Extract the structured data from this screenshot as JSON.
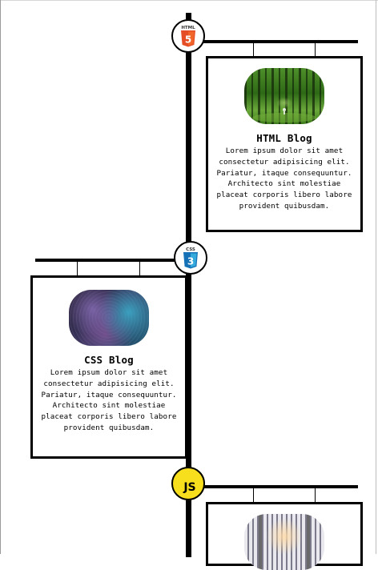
{
  "timeline": {
    "entries": [
      {
        "icon": "html5-icon",
        "icon_caption": "HTML",
        "icon_symbol": "5",
        "title": "HTML Blog",
        "body": "Lorem ipsum dolor sit amet consectetur adipisicing elit. Pariatur, itaque consequuntur. Architecto sint molestiae placeat corporis libero labore provident quibusdam.",
        "image": "forest-image",
        "side": "right"
      },
      {
        "icon": "css3-icon",
        "icon_caption": "CSS",
        "icon_symbol": "3",
        "title": "CSS Blog",
        "body": "Lorem ipsum dolor sit amet consectetur adipisicing elit. Pariatur, itaque consequuntur. Architecto sint molestiae placeat corporis libero labore provident quibusdam.",
        "image": "water-droplets-image",
        "side": "left"
      },
      {
        "icon": "javascript-icon",
        "icon_symbol": "JS",
        "title": "",
        "body": "",
        "image": "interior-room-image",
        "side": "right"
      }
    ]
  },
  "colors": {
    "html5": "#e44d26",
    "css3": "#2965f1",
    "javascript": "#f7df1e",
    "line": "#000000"
  }
}
